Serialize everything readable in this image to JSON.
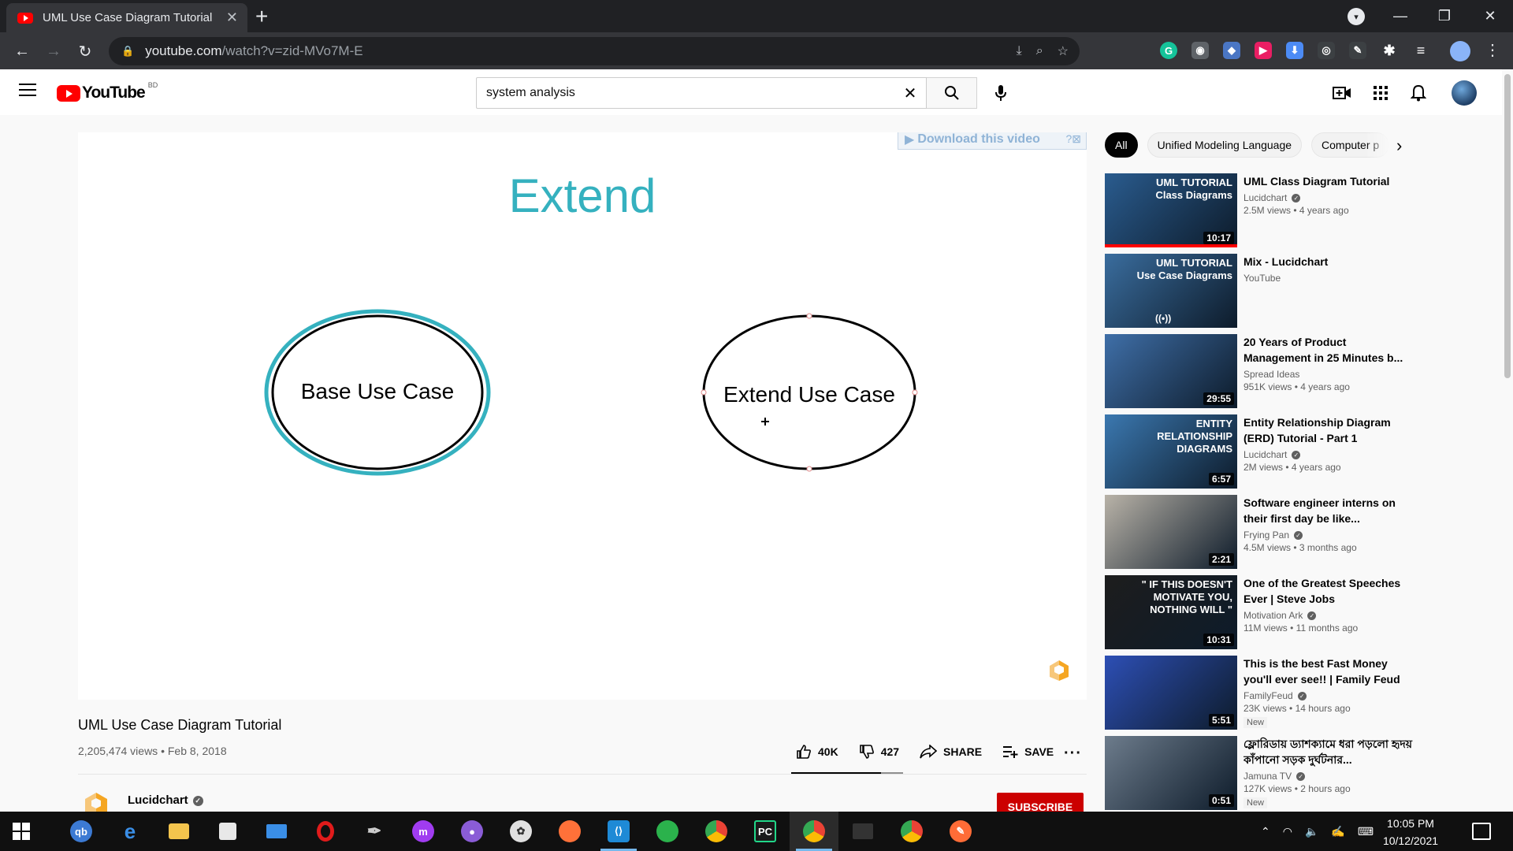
{
  "browser": {
    "tab_title": "UML Use Case Diagram Tutorial",
    "url_host": "youtube.com",
    "url_path": "/watch?v=zid-MVo7M-E"
  },
  "youtube": {
    "country_code": "BD",
    "search_value": "system analysis"
  },
  "player": {
    "download_banner": "Download this video",
    "slide_title": "Extend",
    "base_use_case": "Base Use Case",
    "extend_use_case": "Extend Use Case"
  },
  "video": {
    "title": "UML Use Case Diagram Tutorial",
    "views": "2,205,474 views",
    "date": "Feb 8, 2018",
    "likes": "40K",
    "dislikes": "427",
    "share_label": "SHARE",
    "save_label": "SAVE",
    "channel": "Lucidchart",
    "subscribe_label": "SUBSCRIBE"
  },
  "chips": [
    "All",
    "Unified Modeling Language",
    "Computer p"
  ],
  "recommendations": [
    {
      "title": "UML Class Diagram Tutorial",
      "channel": "Lucidchart",
      "verified": true,
      "views": "2.5M views",
      "age": "4 years ago",
      "duration": "10:17",
      "thumb_text": "UML TUTORIAL\nClass Diagrams",
      "thumb_color": "#2a5c8f",
      "watched": 1.0
    },
    {
      "title": "Mix - Lucidchart",
      "channel": "YouTube",
      "verified": false,
      "views": "",
      "age": "",
      "duration": "",
      "thumb_text": "UML TUTORIAL\nUse Case Diagrams",
      "thumb_color": "#3a6d9e",
      "watched": 0
    },
    {
      "title": "20 Years of Product Management in 25 Minutes b...",
      "channel": "Spread Ideas",
      "verified": false,
      "views": "951K views",
      "age": "4 years ago",
      "duration": "29:55",
      "thumb_text": "",
      "thumb_color": "#3f6fa8",
      "watched": 0
    },
    {
      "title": "Entity Relationship Diagram (ERD) Tutorial - Part 1",
      "channel": "Lucidchart",
      "verified": true,
      "views": "2M views",
      "age": "4 years ago",
      "duration": "6:57",
      "thumb_text": "ENTITY\nRELATIONSHIP\nDIAGRAMS",
      "thumb_color": "#3b78b0",
      "watched": 0
    },
    {
      "title": "Software engineer interns on their first day be like...",
      "channel": "Frying Pan",
      "verified": true,
      "views": "4.5M views",
      "age": "3 months ago",
      "duration": "2:21",
      "thumb_text": "",
      "thumb_color": "#b9b3a8",
      "watched": 0
    },
    {
      "title": "One of the Greatest Speeches Ever | Steve Jobs",
      "channel": "Motivation Ark",
      "verified": true,
      "views": "11M views",
      "age": "11 months ago",
      "duration": "10:31",
      "thumb_text": "\" IF THIS DOESN'T\nMOTIVATE YOU,\nNOTHING WILL \"",
      "thumb_color": "#1d1d1d",
      "watched": 0
    },
    {
      "title": "This is the best Fast Money you'll ever see!! | Family Feud",
      "channel": "FamilyFeud",
      "verified": true,
      "views": "23K views",
      "age": "14 hours ago",
      "duration": "5:51",
      "thumb_text": "",
      "thumb_color": "#2d4fb5",
      "watched": 0,
      "badge": "New"
    },
    {
      "title": "ফ্লোরিডায় ড্যাশক্যামে ধরা পড়লো হৃদয় কাঁপানো সড়ক দুর্ঘটনার...",
      "channel": "Jamuna TV",
      "verified": true,
      "views": "127K views",
      "age": "2 hours ago",
      "duration": "0:51",
      "thumb_text": "",
      "thumb_color": "#6d7c8c",
      "watched": 0,
      "badge": "New"
    }
  ],
  "taskbar": {
    "time": "10:05 PM",
    "date": "10/12/2021"
  },
  "colors": {
    "accent_teal": "#35b1bf",
    "youtube_red": "#ff0000",
    "subscribe_red": "#cc0000"
  }
}
